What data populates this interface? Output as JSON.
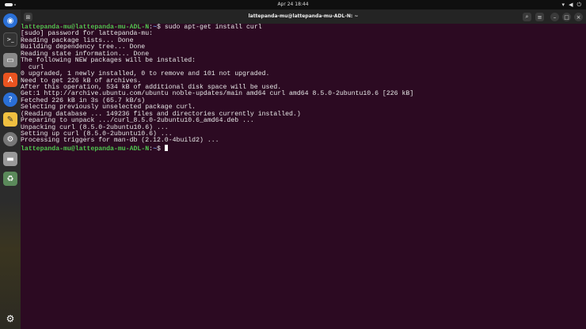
{
  "topbar": {
    "clock": "Apr 24  18:44",
    "tray_icons": [
      "wifi-icon",
      "volume-icon",
      "power-icon"
    ]
  },
  "dock": {
    "apps": [
      "chromium-icon",
      "terminal-icon",
      "files-icon",
      "app-center-icon",
      "help-icon",
      "text-editor-icon",
      "settings-icon",
      "drive-icon",
      "trash-icon"
    ],
    "show_apps": "show-apps-icon"
  },
  "window": {
    "title": "lattepanda-mu@lattepanda-mu-ADL-N: ~"
  },
  "terminal": {
    "prompt_user": "lattepanda-mu@lattepanda-mu-ADL-N",
    "prompt_path": "~",
    "command": "sudo apt-get install curl",
    "output": [
      "[sudo] password for lattepanda-mu:",
      "Reading package lists... Done",
      "Building dependency tree... Done",
      "Reading state information... Done",
      "The following NEW packages will be installed:",
      "  curl",
      "0 upgraded, 1 newly installed, 0 to remove and 101 not upgraded.",
      "Need to get 226 kB of archives.",
      "After this operation, 534 kB of additional disk space will be used.",
      "Get:1 http://archive.ubuntu.com/ubuntu noble-updates/main amd64 curl amd64 8.5.0-2ubuntu10.6 [226 kB]",
      "Fetched 226 kB in 3s (65.7 kB/s)",
      "Selecting previously unselected package curl.",
      "(Reading database ... 149236 files and directories currently installed.)",
      "Preparing to unpack .../curl_8.5.0-2ubuntu10.6_amd64.deb ...",
      "Unpacking curl (8.5.0-2ubuntu10.6) ...",
      "Setting up curl (8.5.0-2ubuntu10.6) ...",
      "Processing triggers for man-db (2.12.0-4build2) ..."
    ]
  }
}
